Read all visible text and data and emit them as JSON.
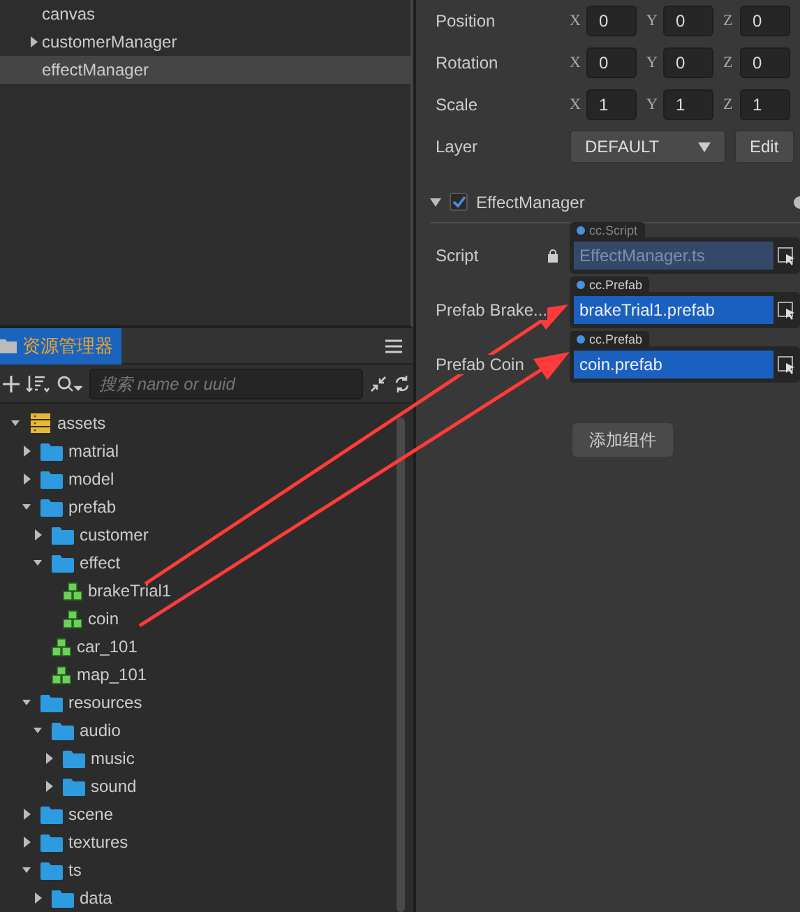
{
  "hierarchy": {
    "items": [
      {
        "label": "canvas",
        "selected": false
      },
      {
        "label": "customerManager",
        "selected": false,
        "expanded": false
      },
      {
        "label": "effectManager",
        "selected": true
      }
    ]
  },
  "assets_panel": {
    "tab": {
      "label": "资源管理器",
      "selected": true
    },
    "search": {
      "placeholder": "搜索 name or uuid"
    },
    "tree": [
      {
        "label": "assets",
        "kind": "database",
        "expanded": true,
        "children": [
          {
            "label": "matrial",
            "kind": "folder",
            "expanded": false
          },
          {
            "label": "model",
            "kind": "folder",
            "expanded": false
          },
          {
            "label": "prefab",
            "kind": "folder",
            "expanded": true,
            "children": [
              {
                "label": "customer",
                "kind": "folder",
                "expanded": false
              },
              {
                "label": "effect",
                "kind": "folder",
                "expanded": true,
                "children": [
                  {
                    "label": "brakeTrial1",
                    "kind": "prefab"
                  },
                  {
                    "label": "coin",
                    "kind": "prefab"
                  }
                ]
              },
              {
                "label": "car_101",
                "kind": "prefab"
              },
              {
                "label": "map_101",
                "kind": "prefab"
              }
            ]
          },
          {
            "label": "resources",
            "kind": "folder",
            "expanded": true,
            "children": [
              {
                "label": "audio",
                "kind": "folder",
                "expanded": true,
                "children": [
                  {
                    "label": "music",
                    "kind": "folder",
                    "expanded": false
                  },
                  {
                    "label": "sound",
                    "kind": "folder",
                    "expanded": false
                  }
                ]
              }
            ]
          },
          {
            "label": "scene",
            "kind": "folder",
            "expanded": false
          },
          {
            "label": "textures",
            "kind": "folder",
            "expanded": false
          },
          {
            "label": "ts",
            "kind": "folder",
            "expanded": true,
            "children": [
              {
                "label": "data",
                "kind": "folder",
                "expanded": false
              }
            ]
          }
        ]
      }
    ]
  },
  "inspector": {
    "transform": [
      {
        "label": "Position",
        "axes": [
          {
            "axis": "X",
            "value": "0"
          },
          {
            "axis": "Y",
            "value": "0"
          },
          {
            "axis": "Z",
            "value": "0"
          }
        ]
      },
      {
        "label": "Rotation",
        "axes": [
          {
            "axis": "X",
            "value": "0"
          },
          {
            "axis": "Y",
            "value": "0"
          },
          {
            "axis": "Z",
            "value": "0"
          }
        ]
      },
      {
        "label": "Scale",
        "axes": [
          {
            "axis": "X",
            "value": "1"
          },
          {
            "axis": "Y",
            "value": "1"
          },
          {
            "axis": "Z",
            "value": "1"
          }
        ]
      }
    ],
    "layer": {
      "label": "Layer",
      "value": "DEFAULT",
      "button": "Edit"
    },
    "component": {
      "name": "EffectManager",
      "expanded": true,
      "checked": true,
      "properties": [
        {
          "label": "Script",
          "type": "cc.Script",
          "value": "EffectManager.ts",
          "locked": true
        },
        {
          "label": "Prefab Brake...",
          "type": "cc.Prefab",
          "value": "brakeTrial1.prefab",
          "locked": false
        },
        {
          "label": "Prefab Coin",
          "type": "cc.Prefab",
          "value": "coin.prefab",
          "locked": false
        }
      ]
    },
    "add_button": "添加组件"
  }
}
